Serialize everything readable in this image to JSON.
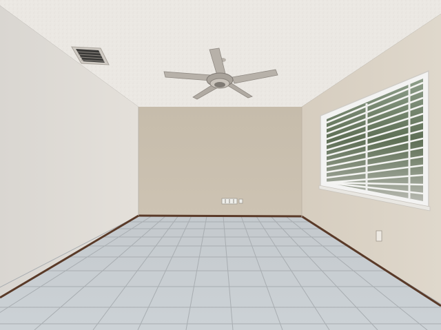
{
  "scene": {
    "description_icons": {
      "fan": "ceiling-fan-icon",
      "vent": "air-vent-icon",
      "window": "window-blinds-icon",
      "outlet": "wall-outlet-icon"
    },
    "colors": {
      "ceiling": "#ebe8e3",
      "left_wall": "#dedad4",
      "back_wall": "#c9bfae",
      "right_wall": "#d8d0c3",
      "floor": "#c6ccd0",
      "grout": "#a9adb0",
      "baseboard": "#5a3a28",
      "fan_metal": "#b9b3ab",
      "window_frame": "#f2f2f2"
    }
  }
}
